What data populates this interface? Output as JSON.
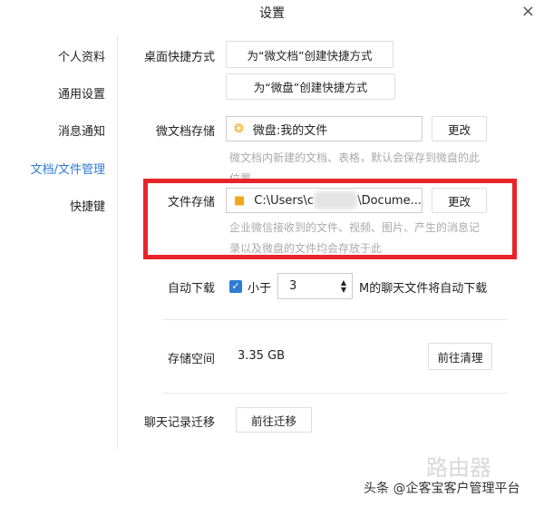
{
  "window": {
    "title": "设置",
    "close_icon": "×"
  },
  "sidebar": {
    "items": [
      {
        "label": "个人资料"
      },
      {
        "label": "通用设置"
      },
      {
        "label": "消息通知"
      },
      {
        "label": "文档/文件管理",
        "active": true
      },
      {
        "label": "快捷键"
      }
    ]
  },
  "shortcut": {
    "label": "桌面快捷方式",
    "btn_doc": "为“微文档”创建快捷方式",
    "btn_disk": "为“微盘”创建快捷方式"
  },
  "doc_storage": {
    "label": "微文档存储",
    "value": "微盘:我的文件",
    "change": "更改",
    "hint": "微文档内新建的文档、表格，默认会保存到微盘的此位置"
  },
  "file_storage": {
    "label": "文件存储",
    "value_prefix": "C:\\Users\\c",
    "value_suffix": "\\Docume...",
    "change": "更改",
    "hint": "企业微信接收到的文件、视频、图片、产生的消息记录以及微盘的文件均会存放于此"
  },
  "auto_download": {
    "label": "自动下载",
    "checkbox_label": "小于",
    "value": "3",
    "suffix": "M的聊天文件将自动下载"
  },
  "storage": {
    "label": "存储空间",
    "value": "3.35 GB",
    "button": "前往清理"
  },
  "migrate": {
    "label": "聊天记录迁移",
    "button": "前往迁移"
  },
  "watermark": {
    "text": "头条 @企客宝客户管理平台",
    "logo": "路由器"
  },
  "colors": {
    "accent": "#2f7bd6",
    "highlight": "#e8242a"
  }
}
